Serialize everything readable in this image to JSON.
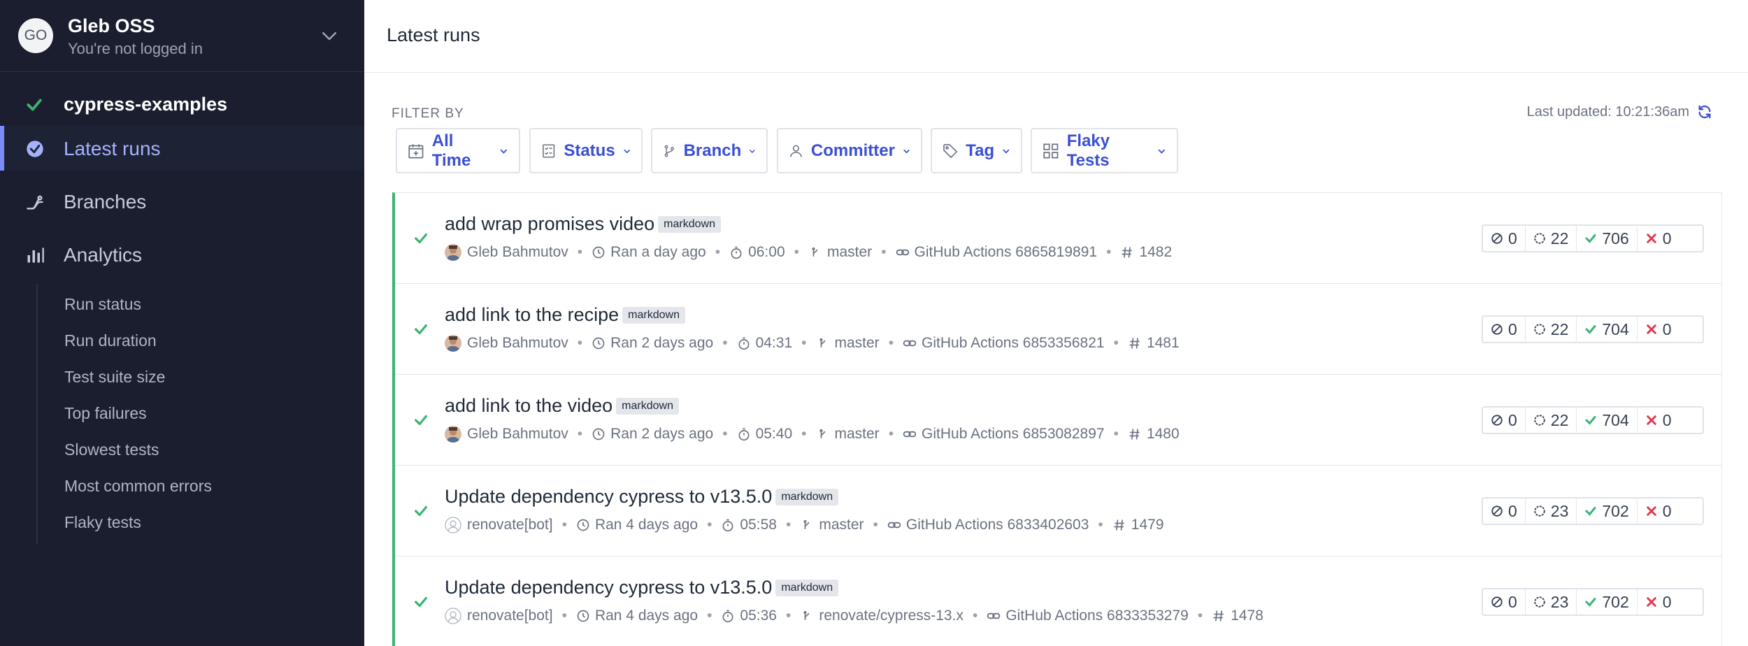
{
  "sidebar": {
    "org": {
      "avatar_initials": "GO",
      "name": "Gleb OSS",
      "subtitle": "You're not logged in"
    },
    "project": {
      "name": "cypress-examples",
      "status": "passed"
    },
    "nav": [
      {
        "label": "Latest runs",
        "icon": "check-circle-icon",
        "active": true
      },
      {
        "label": "Branches",
        "icon": "branches-icon",
        "active": false
      },
      {
        "label": "Analytics",
        "icon": "bar-chart-icon",
        "active": false
      }
    ],
    "analytics_items": [
      "Run status",
      "Run duration",
      "Test suite size",
      "Top failures",
      "Slowest tests",
      "Most common errors",
      "Flaky tests"
    ]
  },
  "header": {
    "title": "Latest runs"
  },
  "filters": {
    "label": "FILTER BY",
    "last_updated": "Last updated: 10:21:36am",
    "buttons": [
      {
        "label": "All Time",
        "icon": "calendar-icon"
      },
      {
        "label": "Status",
        "icon": "checklist-icon"
      },
      {
        "label": "Branch",
        "icon": "branch-icon"
      },
      {
        "label": "Committer",
        "icon": "user-icon"
      },
      {
        "label": "Tag",
        "icon": "tag-icon"
      },
      {
        "label": "Flaky Tests",
        "icon": "grid-icon"
      }
    ]
  },
  "colors": {
    "accent": "#3b4fd6",
    "passed": "#3cb371",
    "failed": "#e0384b",
    "sidebar_bg": "#1b1e2e"
  },
  "runs": [
    {
      "title": "add wrap promises video",
      "tag": "markdown",
      "author": "Gleb Bahmutov",
      "author_avatar": "photo",
      "time": "Ran a day ago",
      "duration": "06:00",
      "branch": "master",
      "ci": "GitHub Actions 6865819891",
      "number": "1482",
      "skipped": "0",
      "pending": "22",
      "passed": "706",
      "failed": "0"
    },
    {
      "title": "add link to the recipe",
      "tag": "markdown",
      "author": "Gleb Bahmutov",
      "author_avatar": "photo",
      "time": "Ran 2 days ago",
      "duration": "04:31",
      "branch": "master",
      "ci": "GitHub Actions 6853356821",
      "number": "1481",
      "skipped": "0",
      "pending": "22",
      "passed": "704",
      "failed": "0"
    },
    {
      "title": "add link to the video",
      "tag": "markdown",
      "author": "Gleb Bahmutov",
      "author_avatar": "photo",
      "time": "Ran 2 days ago",
      "duration": "05:40",
      "branch": "master",
      "ci": "GitHub Actions 6853082897",
      "number": "1480",
      "skipped": "0",
      "pending": "22",
      "passed": "704",
      "failed": "0"
    },
    {
      "title": "Update dependency cypress to v13.5.0",
      "tag": "markdown",
      "author": "renovate[bot]",
      "author_avatar": "placeholder",
      "time": "Ran 4 days ago",
      "duration": "05:58",
      "branch": "master",
      "ci": "GitHub Actions 6833402603",
      "number": "1479",
      "skipped": "0",
      "pending": "23",
      "passed": "702",
      "failed": "0"
    },
    {
      "title": "Update dependency cypress to v13.5.0",
      "tag": "markdown",
      "author": "renovate[bot]",
      "author_avatar": "placeholder",
      "time": "Ran 4 days ago",
      "duration": "05:36",
      "branch": "renovate/cypress-13.x",
      "ci": "GitHub Actions 6833353279",
      "number": "1478",
      "skipped": "0",
      "pending": "23",
      "passed": "702",
      "failed": "0"
    }
  ]
}
